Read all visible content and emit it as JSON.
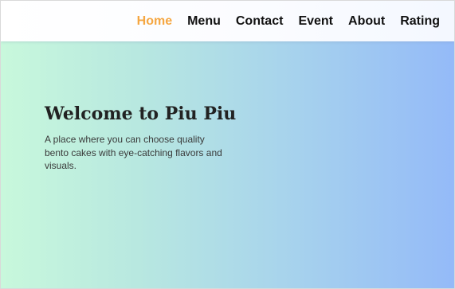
{
  "nav": {
    "items": [
      {
        "label": "Home",
        "active": true
      },
      {
        "label": "Menu",
        "active": false
      },
      {
        "label": "Contact",
        "active": false
      },
      {
        "label": "Event",
        "active": false
      },
      {
        "label": "About",
        "active": false
      },
      {
        "label": "Rating",
        "active": false
      }
    ]
  },
  "hero": {
    "title": "Welcome to Piu Piu",
    "description": "A place where you can choose quality bento cakes with eye-catching flavors and visuals."
  },
  "colors": {
    "accent": "#f5a742",
    "nav_text": "#111111",
    "gradient_start": "#c8f8dc",
    "gradient_end": "#94baf8"
  }
}
